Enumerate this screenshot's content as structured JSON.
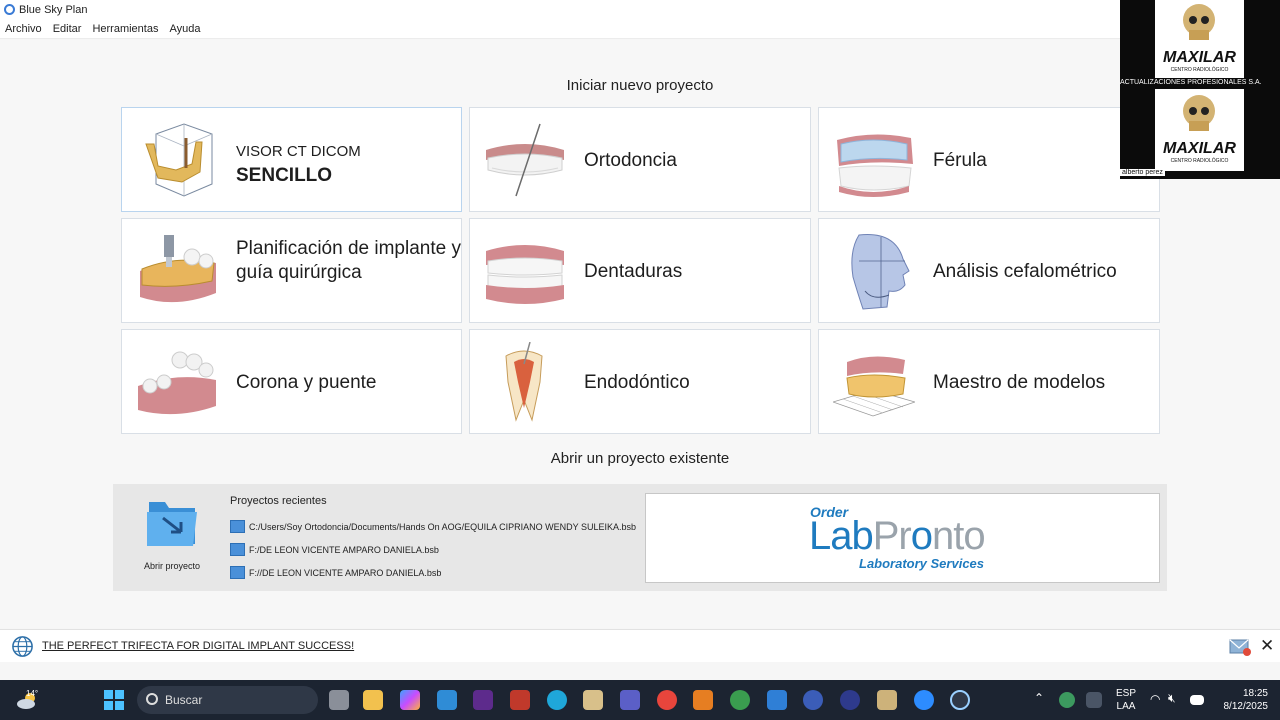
{
  "window": {
    "title": "Blue Sky Plan"
  },
  "menu": [
    "Archivo",
    "Editar",
    "Herramientas",
    "Ayuda"
  ],
  "new_project": {
    "title": "Iniciar nuevo proyecto",
    "tiles": [
      {
        "line1": "VISOR CT DICOM",
        "line2": "SENCILLO",
        "icon": "ct-jaw-cube-icon"
      },
      {
        "label": "Ortodoncia",
        "icon": "teeth-orthodontics-icon"
      },
      {
        "label": "Férula",
        "icon": "splint-icon"
      },
      {
        "label": "Planificación de implante y guía quirúrgica",
        "icon": "implant-guide-icon"
      },
      {
        "label": "Dentaduras",
        "icon": "dentures-icon"
      },
      {
        "label": "Análisis cefalométrico",
        "icon": "cephalometric-head-icon"
      },
      {
        "label": "Corona y puente",
        "icon": "crown-bridge-icon"
      },
      {
        "label": "Endodóntico",
        "icon": "endodontic-tooth-icon"
      },
      {
        "label": "Maestro de modelos",
        "icon": "model-master-icon"
      }
    ]
  },
  "open_project": {
    "title": "Abrir un proyecto existente",
    "open_label": "Abrir proyecto",
    "recent_title": "Proyectos recientes",
    "recent": [
      "C:/Users/Soy Ortodoncia/Documents/Hands On AOG/EQUILA CIPRIANO WENDY SULEIKA.bsb",
      "F:/DE LEON VICENTE  AMPARO DANIELA.bsb",
      "F://DE LEON VICENTE  AMPARO DANIELA.bsb"
    ]
  },
  "ad": {
    "order": "Order",
    "lab": "Lab",
    "pronto_p": "Pr",
    "pronto_o": "o",
    "pronto_rest": "nto",
    "sub": "Laboratory Services"
  },
  "news": {
    "text": "THE PERFECT TRIFECTA FOR DIGITAL IMPLANT SUCCESS!"
  },
  "webcam": {
    "logo": "MAXILAR",
    "sub": "CENTRO RADIOLÓGICO",
    "banner": "ACTUALIZACIONES PROFESIONALES S.A.",
    "name": "alberto perez"
  },
  "taskbar": {
    "temp": "14°",
    "search": "Buscar",
    "lang1": "ESP",
    "lang2": "LAA",
    "time": "18:25",
    "date": "8/12/2025"
  }
}
